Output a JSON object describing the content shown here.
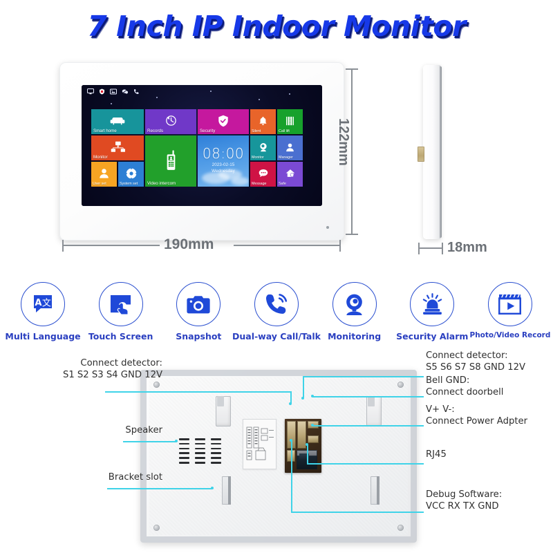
{
  "title": "7 Inch IP Indoor Monitor",
  "device": {
    "front_view": {
      "width_label": "190mm",
      "height_label": "122mm"
    },
    "side_view": {
      "depth_label": "18mm"
    },
    "screen": {
      "statusbar_icons": [
        "monitor-icon",
        "shield-record-icon",
        "photo-icon",
        "message-mute-icon",
        "phone-icon"
      ],
      "clock": {
        "time": "08:00",
        "date": "2023-02-15",
        "weekday": "Wednesday"
      },
      "tiles": [
        {
          "id": "smart-home",
          "label": "Smart home",
          "icon": "sofa-icon",
          "color": "#17949b"
        },
        {
          "id": "records",
          "label": "Records",
          "icon": "clock-icon",
          "color": "#7038c8"
        },
        {
          "id": "security",
          "label": "Security",
          "icon": "shield-check-icon",
          "color": "#c5189e"
        },
        {
          "id": "monitor",
          "label": "Monitor",
          "icon": "network-icon",
          "color": "#e04a22"
        },
        {
          "id": "user-set",
          "label": "User set",
          "icon": "user-icon",
          "color": "#f7a423"
        },
        {
          "id": "system-set",
          "label": "System set",
          "icon": "gear-icon",
          "color": "#2d7fd4"
        },
        {
          "id": "video-intercom",
          "label": "Video intercom",
          "icon": "walkie-talkie-icon",
          "color": "#22a02b"
        },
        {
          "id": "silent",
          "label": "Silent",
          "icon": "bell-icon",
          "color": "#e8642a"
        },
        {
          "id": "call-lift",
          "label": "Call lift",
          "icon": "elevator-icon",
          "color": "#17a12c"
        },
        {
          "id": "monitor-2",
          "label": "Monitor",
          "icon": "camera-icon",
          "color": "#17969b"
        },
        {
          "id": "manager",
          "label": "Manager",
          "icon": "user-icon",
          "color": "#4a6fd0"
        },
        {
          "id": "message",
          "label": "Message",
          "icon": "chat-bubble-icon",
          "color": "#cf1345"
        },
        {
          "id": "safe",
          "label": "Safe",
          "icon": "home-shield-icon",
          "color": "#7b4ad4"
        }
      ]
    }
  },
  "features": [
    {
      "label": "Multi Language",
      "icon": "translate-icon"
    },
    {
      "label": "Touch Screen",
      "icon": "touch-screen-icon"
    },
    {
      "label": "Snapshot",
      "icon": "camera-icon"
    },
    {
      "label": "Dual-way Call/Talk",
      "icon": "phone-call-icon"
    },
    {
      "label": "Monitoring",
      "icon": "webcam-icon"
    },
    {
      "label": "Security Alarm",
      "icon": "siren-icon"
    },
    {
      "label": "Photo/Video Record",
      "icon": "video-play-icon"
    }
  ],
  "back_annotations": {
    "left": [
      {
        "id": "connect-detector-1",
        "text": "Connect detector:\nS1 S2 S3 S4 GND 12V"
      },
      {
        "id": "speaker",
        "text": "Speaker"
      },
      {
        "id": "bracket-slot",
        "text": "Bracket slot"
      }
    ],
    "right": [
      {
        "id": "connect-detector-2",
        "text": "Connect detector:\nS5 S6 S7 S8 GND 12V"
      },
      {
        "id": "bell-gnd",
        "text": "Bell GND:\nConnect doorbell"
      },
      {
        "id": "power",
        "text": "V+ V-:\nConnect Power Adpter"
      },
      {
        "id": "rj45",
        "text": "RJ45"
      },
      {
        "id": "debug",
        "text": "Debug Software:\nVCC RX TX GND"
      }
    ]
  },
  "colors": {
    "title_blue": "#1739e8",
    "title_shadow": "#0b1a7a",
    "feature_blue": "#2a4fd0",
    "annotation_cyan": "#3fd3e8",
    "dimension_gray": "#6b7076"
  }
}
